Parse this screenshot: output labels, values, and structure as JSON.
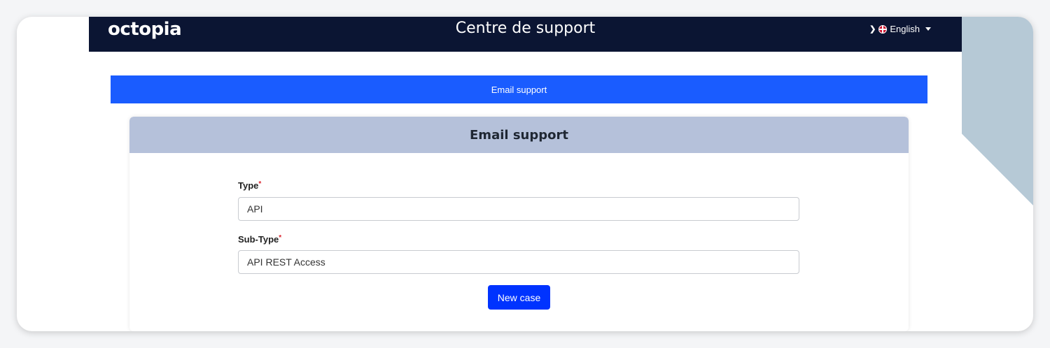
{
  "header": {
    "logo": "octopia",
    "title": "Centre de support",
    "language": "English"
  },
  "tab": {
    "label": "Email support"
  },
  "card": {
    "title": "Email support",
    "fields": [
      {
        "label": "Type",
        "required_mark": "*",
        "value": "API"
      },
      {
        "label": "Sub-Type",
        "required_mark": "*",
        "value": "API REST Access"
      }
    ],
    "button": "New case"
  },
  "colors": {
    "topbar": "#0b1533",
    "tab": "#1a5cff",
    "card_header": "#b5c1da",
    "button": "#0033ff",
    "required": "#d9232d"
  },
  "icons": {
    "menu_toggle": "chevron-down-icon",
    "flag": "uk-flag-icon",
    "dropdown": "caret-down-icon"
  }
}
